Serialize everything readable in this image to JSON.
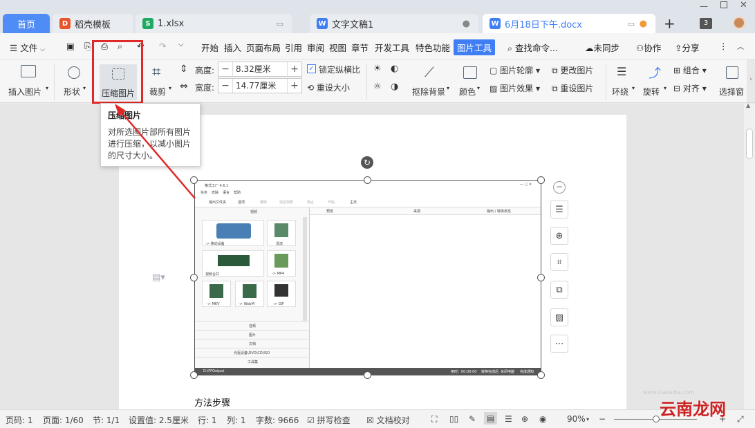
{
  "tabs": {
    "home": "首页",
    "items": [
      {
        "label": "稻壳模板",
        "icon": "D"
      },
      {
        "label": "1.xlsx",
        "icon": "S"
      },
      {
        "label": "文字文稿1",
        "icon": "W"
      },
      {
        "label": "6月18日下午.docx",
        "icon": "W"
      }
    ],
    "add": "+",
    "count": "3"
  },
  "menu": {
    "file": "文件",
    "items": [
      "开始",
      "插入",
      "页面布局",
      "引用",
      "审阅",
      "视图",
      "章节",
      "开发工具",
      "特色功能",
      "图片工具"
    ],
    "active": "图片工具",
    "search": "查找命令...",
    "sync": "未同步",
    "collab": "协作",
    "share": "分享"
  },
  "ribbon": {
    "insert_picture": "插入图片",
    "shape": "形状",
    "compress": "压缩图片",
    "crop": "裁剪",
    "height_label": "高度:",
    "height_value": "8.32厘米",
    "width_label": "宽度:",
    "width_value": "14.77厘米",
    "lock_ratio": "锁定纵横比",
    "reset_size": "重设大小",
    "remove_bg": "抠除背景",
    "color": "颜色",
    "outline": "图片轮廓",
    "effect": "图片效果",
    "change_pic": "更改图片",
    "reset_pic": "重设图片",
    "wrap": "环绕",
    "rotate": "旋转",
    "group": "组合",
    "align": "对齐",
    "select_pane": "选择窗"
  },
  "tooltip": {
    "title": "压缩图片",
    "body": "对所选图片部所有图片进行压缩，以减小图片的尺寸大小。"
  },
  "document": {
    "caption": "方法步骤",
    "embedded": {
      "title": "格式工厂 4.6.1",
      "menus": [
        "任务",
        "皮肤",
        "语言",
        "帮助"
      ],
      "toolbar": [
        "输出文件夹",
        "选项",
        "移除",
        "清空列表",
        "停止",
        "开始",
        "主页"
      ],
      "panel_header": "视频",
      "cols": [
        "预览",
        "来源",
        "输出 / 转换状态"
      ],
      "tiles": [
        "-> 移动设备",
        "混流",
        "视频合并",
        "-> MP4",
        "-> MKV",
        "-> WebM",
        "-> GIF"
      ],
      "categories": [
        "音频",
        "图片",
        "文档",
        "光驱设备\\DVD\\CD\\ISO",
        "工具集"
      ],
      "output_path": "D:\\FFOutput",
      "bottom": [
        "用时：00:00:00",
        "转换完成后",
        "关闭电脑",
        "完成通知"
      ]
    }
  },
  "status": {
    "page": "页码: 1",
    "pages": "页面: 1/60",
    "section": "节: 1/1",
    "setting": "设置值: 2.5厘米",
    "row": "行: 1",
    "col": "列: 1",
    "words": "字数: 9666",
    "spell": "拼写检查",
    "proof": "文档校对",
    "zoom": "90%"
  },
  "watermark": "云南龙网",
  "watermark_url": "www.xiazaiba.com",
  "colors": {
    "accent": "#3f7ef5",
    "highlight": "#e02828"
  }
}
